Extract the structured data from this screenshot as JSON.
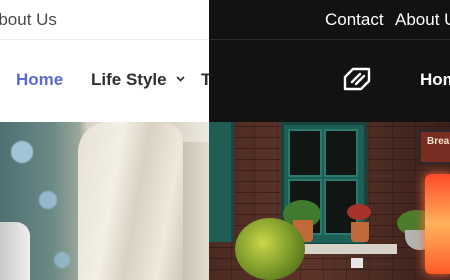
{
  "left": {
    "topbar": {
      "about_link": "About Us"
    },
    "nav": {
      "home": "Home",
      "lifestyle": "Life Style",
      "next_partial": "T"
    }
  },
  "right": {
    "topbar": {
      "contact_link": "Contact",
      "about_link": "About Us"
    },
    "nav": {
      "home": "Home"
    },
    "photo_sign": "Break"
  },
  "colors": {
    "accent": "#5b6bd5",
    "dark_bg": "#121212",
    "light_bg": "#ffffff"
  },
  "icons": [
    "chevron-down-icon",
    "site-logo-icon"
  ]
}
